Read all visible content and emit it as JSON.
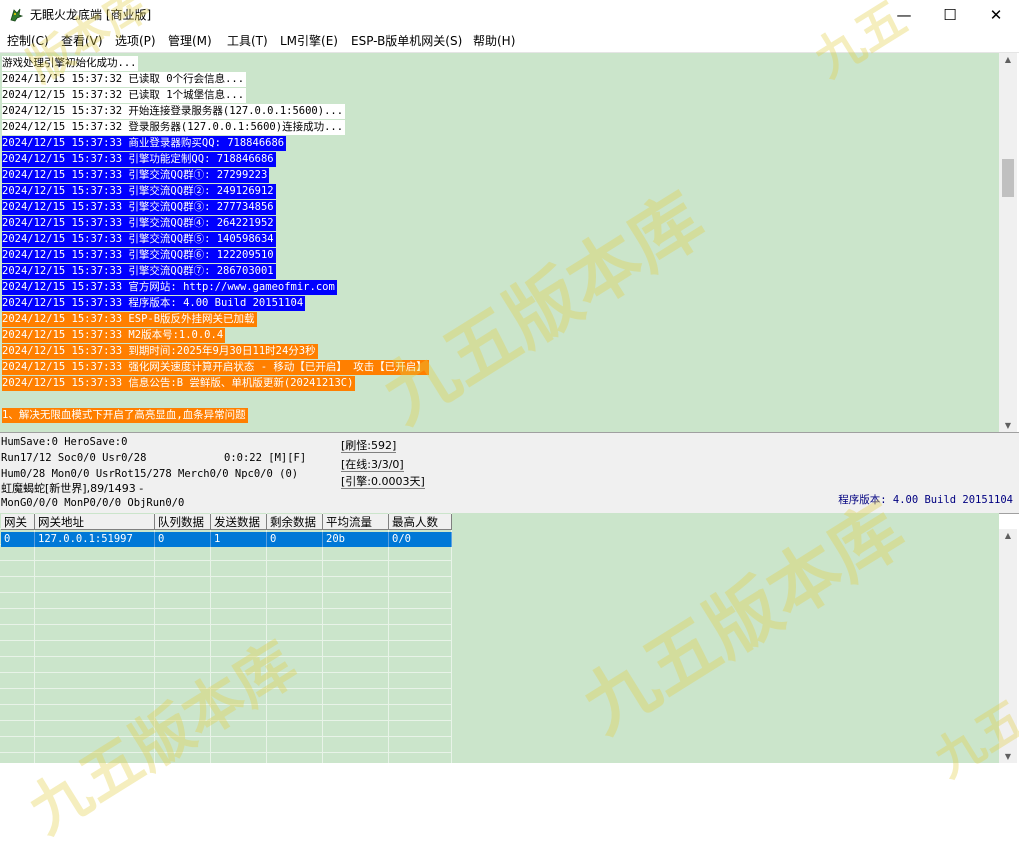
{
  "window": {
    "title": "无眠火龙底端 [商业版]",
    "minimize": "—",
    "maximize": "☐",
    "close": "✕"
  },
  "menu": [
    "控制(C)",
    "查看(V)",
    "选项(P)",
    "管理(M)",
    "工具(T)",
    "LM引擎(E)",
    "ESP-B版单机网关(S)",
    "帮助(H)"
  ],
  "log": [
    {
      "text": "游戏处理引擎初始化成功...",
      "style": "white"
    },
    {
      "text": "2024/12/15 15:37:32 已读取 0个行会信息...",
      "style": "white"
    },
    {
      "text": "2024/12/15 15:37:32 已读取 1个城堡信息...",
      "style": "white"
    },
    {
      "text": "2024/12/15 15:37:32 开始连接登录服务器(127.0.0.1:5600)...",
      "style": "white"
    },
    {
      "text": "2024/12/15 15:37:32 登录服务器(127.0.0.1:5600)连接成功...",
      "style": "white"
    },
    {
      "text": "2024/12/15 15:37:33 商业登录器购买QQ: 718846686",
      "style": "blue"
    },
    {
      "text": "2024/12/15 15:37:33 引擎功能定制QQ: 718846686",
      "style": "blue"
    },
    {
      "text": "2024/12/15 15:37:33 引擎交流QQ群①: 27299223",
      "style": "blue"
    },
    {
      "text": "2024/12/15 15:37:33 引擎交流QQ群②: 249126912",
      "style": "blue"
    },
    {
      "text": "2024/12/15 15:37:33 引擎交流QQ群③: 277734856",
      "style": "blue"
    },
    {
      "text": "2024/12/15 15:37:33 引擎交流QQ群④: 264221952",
      "style": "blue"
    },
    {
      "text": "2024/12/15 15:37:33 引擎交流QQ群⑤: 140598634",
      "style": "blue"
    },
    {
      "text": "2024/12/15 15:37:33 引擎交流QQ群⑥: 122209510",
      "style": "blue"
    },
    {
      "text": "2024/12/15 15:37:33 引擎交流QQ群⑦: 286703001",
      "style": "blue"
    },
    {
      "text": "2024/12/15 15:37:33 官方网站: http://www.gameofmir.com",
      "style": "blue"
    },
    {
      "text": "2024/12/15 15:37:33 程序版本: 4.00 Build 20151104",
      "style": "blue"
    },
    {
      "text": "2024/12/15 15:37:33 ESP-B版反外挂网关已加载",
      "style": "orange"
    },
    {
      "text": "2024/12/15 15:37:33 M2版本号:1.0.0.4",
      "style": "orange"
    },
    {
      "text": "2024/12/15 15:37:33 到期时间:2025年9月30日11时24分3秒",
      "style": "orange"
    },
    {
      "text": "2024/12/15 15:37:33 强化网关速度计算开启状态 - 移动【已开启】 攻击【已开启】",
      "style": "orange"
    },
    {
      "text": "2024/12/15 15:37:33 信息公告:B 尝鲜版、单机版更新(20241213C)",
      "style": "orange"
    },
    {
      "text": "",
      "style": "none"
    },
    {
      "text": "1、解决无限血模式下开启了高亮显血,血条异常问题",
      "style": "orange"
    }
  ],
  "status": {
    "line1": "HumSave:0 HeroSave:0",
    "line2": "Run17/12 Soc0/0 Usr0/28",
    "timer": "0:0:22 [M][F]",
    "line3": "Hum0/28 Mon0/0 UsrRot15/278 Merch0/0 Npc0/0 (0)",
    "line4": "虹魔蝎蛇[新世界],89/1493 -",
    "line5": "MonG0/0/0 MonP0/0/0 ObjRun0/0",
    "refresh": "[刷怪:592]",
    "online": "[在线:3/3/0]",
    "engine": "[引擎:0.0003天]",
    "version": "程序版本: 4.00 Build 20151104"
  },
  "table": {
    "headers": [
      "网关",
      "网关地址",
      "队列数据",
      "发送数据",
      "剩余数据",
      "平均流量",
      "最高人数"
    ],
    "rows": [
      [
        "0",
        "127.0.0.1:51997",
        "0",
        "1",
        "0",
        "20b",
        "0/0"
      ]
    ]
  },
  "colors": {
    "log_bg": "#cbe5cb",
    "blue_line": "#0000ff",
    "orange_line": "#ff7f00",
    "selected_row": "#0078d7"
  }
}
